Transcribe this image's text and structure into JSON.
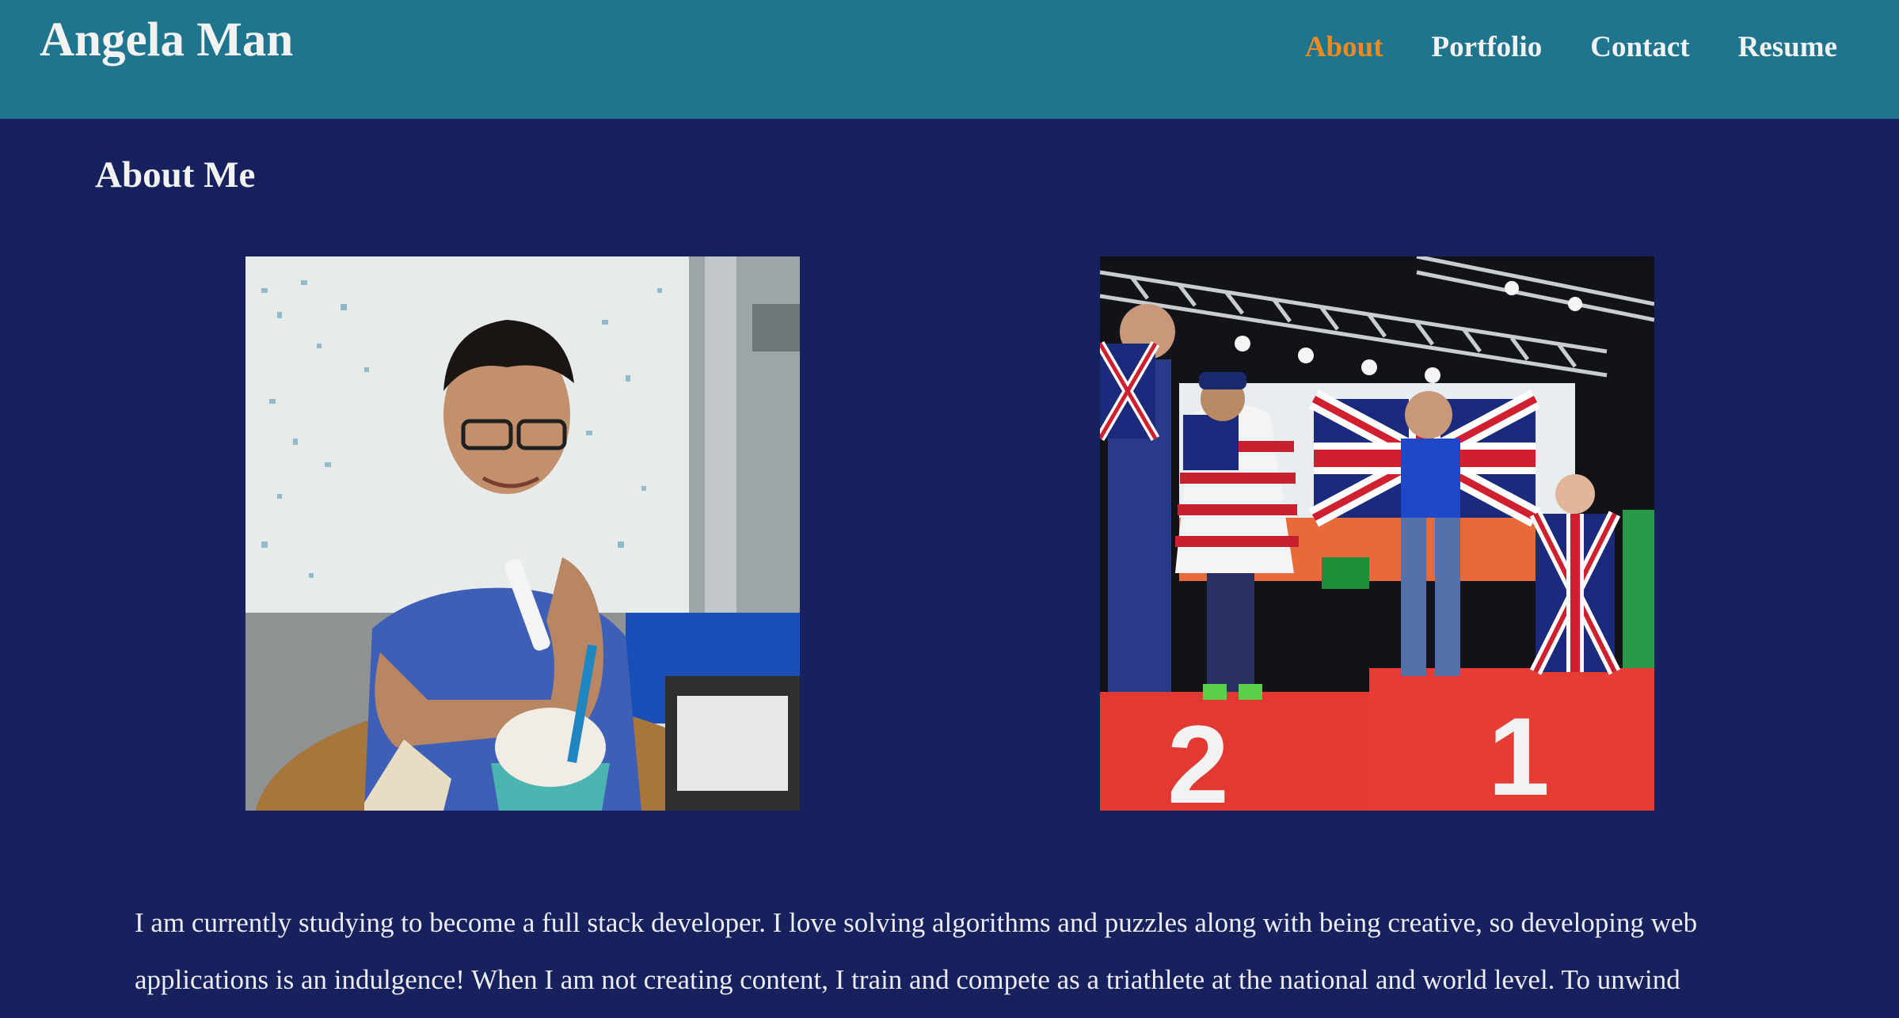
{
  "header": {
    "site_title": "Angela Man",
    "nav": [
      {
        "label": "About",
        "active": true
      },
      {
        "label": "Portfolio",
        "active": false
      },
      {
        "label": "Contact",
        "active": false
      },
      {
        "label": "Resume",
        "active": false
      }
    ]
  },
  "main": {
    "section_title": "About Me",
    "bio": "I am currently studying to become a full stack developer. I love solving algorithms and puzzles along with being creative, so developing web applications is an indulgence! When I am not creating content, I train and compete as a triathlete at the national and world level. To unwind"
  },
  "colors": {
    "header_bg": "#20758e",
    "page_bg": "#17215e",
    "nav_active": "#ee8a1f",
    "text": "#f2f2f2"
  }
}
